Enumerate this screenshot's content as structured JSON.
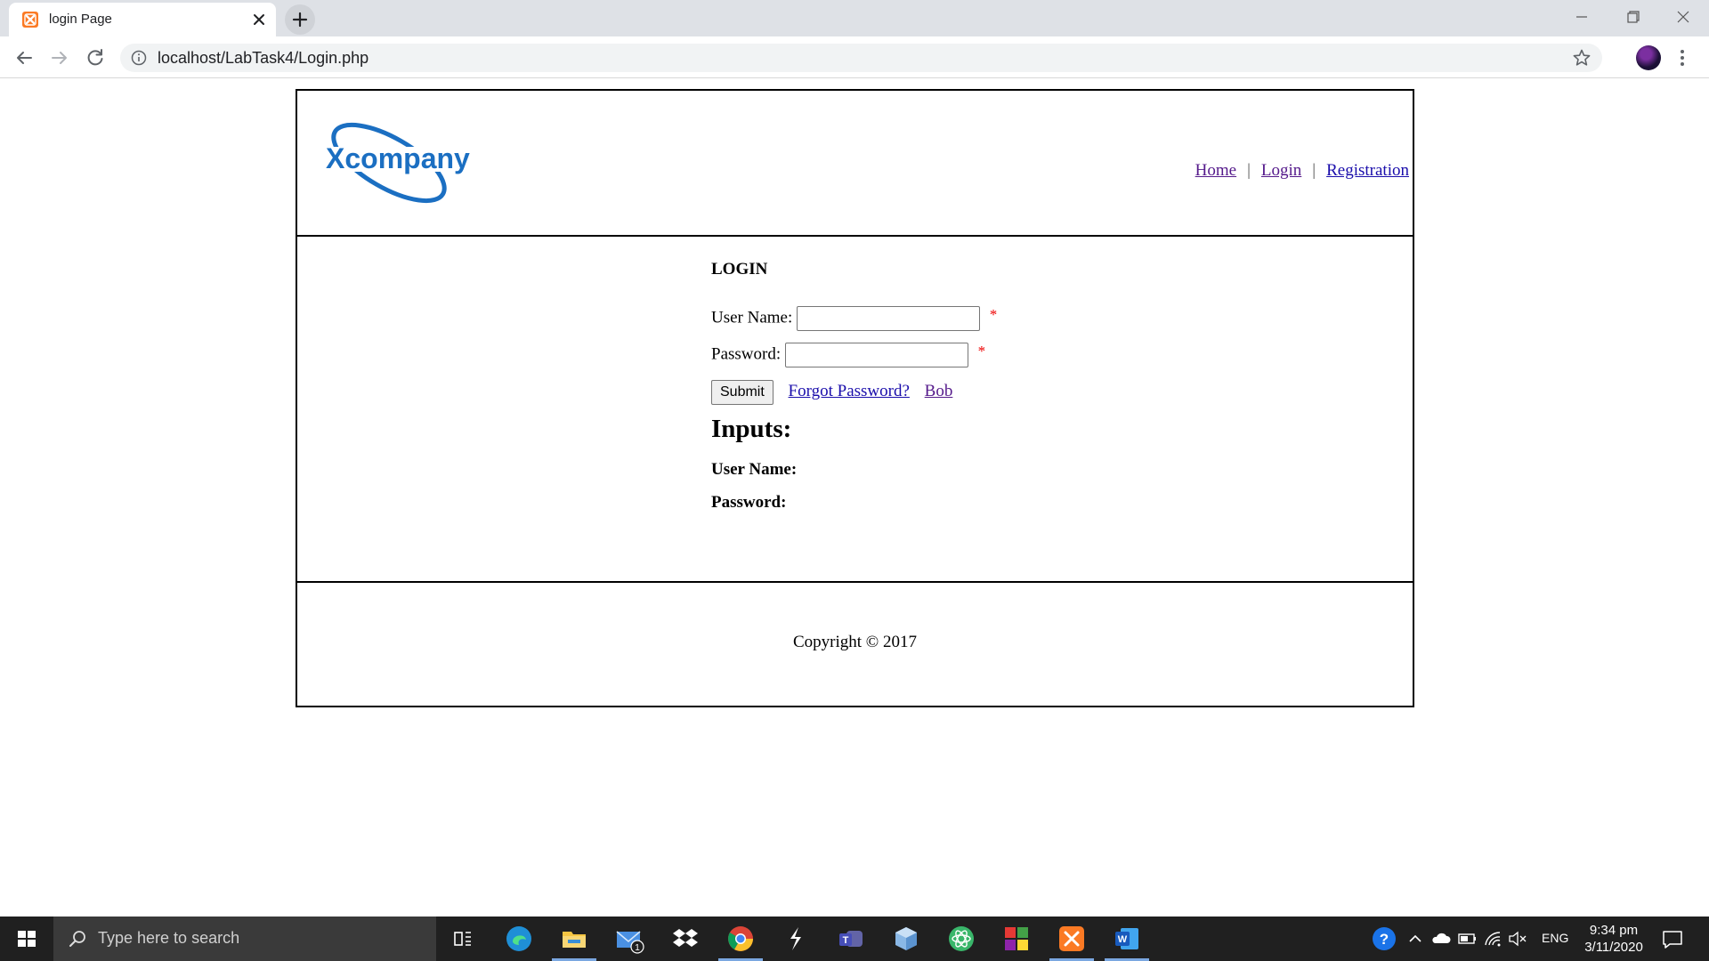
{
  "browser": {
    "tab_title": "login Page",
    "url": "localhost/LabTask4/Login.php"
  },
  "site": {
    "logo_text": "Xcompany",
    "nav": [
      {
        "label": "Home"
      },
      {
        "label": "Login"
      },
      {
        "label": "Registration"
      }
    ],
    "nav_separator": "|"
  },
  "login": {
    "heading": "LOGIN",
    "username_label": "User Name:",
    "username_value": "",
    "password_label": "Password:",
    "password_value": "",
    "required_marker": "*",
    "submit_label": "Submit",
    "forgot_link": "Forgot Password?",
    "extra_link": "Bob"
  },
  "inputs_section": {
    "heading": "Inputs:",
    "username_label": "User Name:",
    "password_label": "Password:"
  },
  "footer": {
    "copyright": "Copyright © 2017"
  },
  "taskbar": {
    "search_placeholder": "Type here to search",
    "mail_badge": "1",
    "language": "ENG",
    "time": "9:34 pm",
    "date": "3/11/2020"
  },
  "colors": {
    "link": "#1a0dab",
    "visited_link": "#551a8b",
    "required": "#e00000",
    "logo_blue": "#1b6fc2"
  }
}
